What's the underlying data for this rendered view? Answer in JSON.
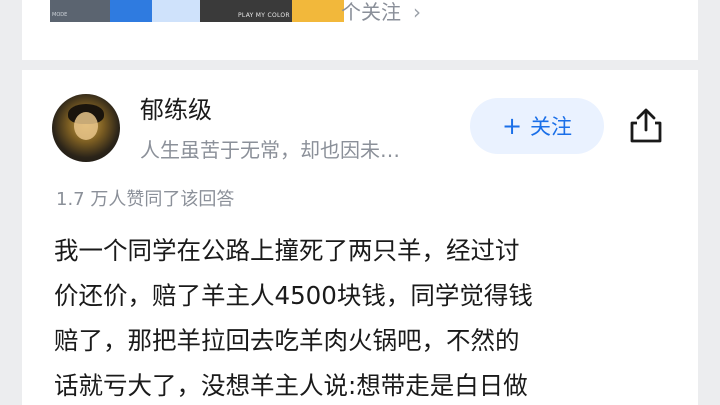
{
  "top_strip": {
    "banner_caption": "PLAY MY COLOR",
    "banner_small": "MODE",
    "follow_link_text": "个关注",
    "chevron": "›"
  },
  "answer": {
    "author_name": "郁练级",
    "author_bio": "人生虽苦于无常，却也因未…",
    "follow_button_label": "关注",
    "follow_icon": "+",
    "share_icon": "share-icon",
    "likes_text": "1.7 万人赞同了该回答",
    "body_lines": [
      "我一个同学在公路上撞死了两只羊，经过讨",
      "价还价，赔了羊主人4500块钱，同学觉得钱",
      "赔了，那把羊拉回去吃羊肉火锅吧，不然的",
      "话就亏大了，没想羊主人说:想带走是白日做"
    ]
  },
  "colors": {
    "accent": "#1a6fe8",
    "accent_bg": "#eaf2ff",
    "muted_text": "#8b9099",
    "background": "#ecedef"
  }
}
